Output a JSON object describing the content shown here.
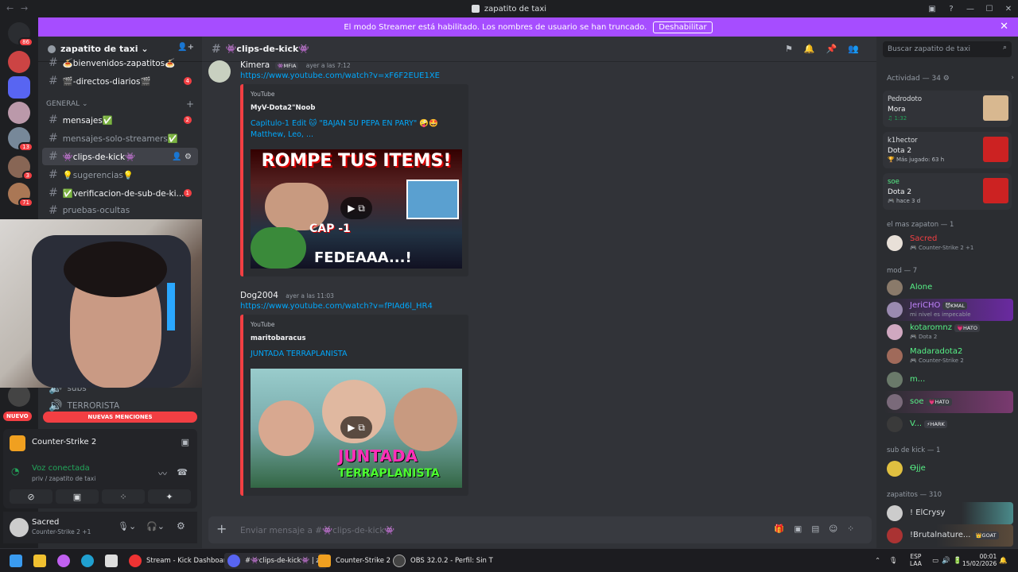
{
  "window": {
    "title": "zapatito de taxi",
    "back": "←",
    "forward": "→",
    "min": "—",
    "max": "☐",
    "close": "✕"
  },
  "banner": {
    "text": "El modo Streamer está habilitado. Los nombres de usuario se han truncado.",
    "button": "Deshabilitar",
    "close": "✕"
  },
  "guilds": [
    {
      "badge": "86",
      "color": "#e9e9e9"
    },
    {
      "badge": "",
      "color": "#c44"
    },
    {
      "badge": "",
      "color": "#5865f2"
    },
    {
      "badge": "",
      "color": "#b9a"
    },
    {
      "badge": "13",
      "color": "#789"
    },
    {
      "badge": "3",
      "color": "#865"
    },
    {
      "badge": "71",
      "color": "#a75"
    }
  ],
  "guild": {
    "name": "zapatito de taxi ⌄",
    "invite_icon": "👤+"
  },
  "channels": [
    {
      "name": "🍝bienvenidos-zapatitos🍝",
      "count": "",
      "state": "unread"
    },
    {
      "name": "🎬-directos-diarios🎬",
      "count": "4",
      "state": "unread"
    },
    {
      "name": "mensajes✅",
      "count": "2",
      "state": "unread"
    },
    {
      "name": "mensajes-solo-streamers✅",
      "count": "",
      "state": "normal"
    },
    {
      "name": "👾clips-de-kick👾",
      "count": "",
      "state": "active"
    },
    {
      "name": "💡sugerencias💡",
      "count": "",
      "state": "normal"
    },
    {
      "name": "✅verificacion-de-sub-de-ki...",
      "count": "1",
      "state": "unread"
    },
    {
      "name": "pruebas-ocultas",
      "count": "",
      "state": "normal"
    }
  ],
  "category": {
    "name": "GENERAL ⌄",
    "add": "+"
  },
  "voice_channels": [
    {
      "name": "subs"
    },
    {
      "name": "TERRORISTA"
    }
  ],
  "new_mentions": {
    "badge": "NUEVO",
    "label": "NUEVAS MENCIONES"
  },
  "activity_panel": {
    "game": "Counter-Strike 2",
    "voice_status": "Voz conectada",
    "voice_channel": "priv / zapatito de taxi"
  },
  "user": {
    "name": "Sacred",
    "status": "Counter-Strike 2 +1"
  },
  "chat": {
    "channel": "👾clips-de-kick👾",
    "messages": [
      {
        "author": "Kimera",
        "badge": "👾MFIA",
        "time": "ayer a las 7:12",
        "link": "https://www.youtube.com/watch?v=xF6F2EUE1XE",
        "embed": {
          "provider": "YouTube",
          "author": "MyV-Dota2\"Noob",
          "title": "Capitulo-1 Edit 🐱 \"BAJAN SU PEPA EN PARY\" 🤪🤩 Matthew, Leo, ...",
          "thumb_top": "ROMPE TUS ITEMS!",
          "thumb_mid": "CAP -1",
          "thumb_bottom": "FEDEAAA...!"
        }
      },
      {
        "author": "Dog2004",
        "badge": "",
        "time": "ayer a las 11:03",
        "link": "https://www.youtube.com/watch?v=fPIAd6l_HR4",
        "embed": {
          "provider": "YouTube",
          "author": "maritobaracus",
          "title": "JUNTADA TERRAPLANISTA",
          "thumb_top": "JUNTADA",
          "thumb_bottom": "TERRAPLANISTA"
        }
      }
    ],
    "composer_placeholder": "Enviar mensaje a #👾clips-de-kick👾"
  },
  "members": {
    "search_placeholder": "Buscar zapatito de taxi",
    "activity_header": "Actividad — 34 ⚙",
    "activities": [
      {
        "user": "Pedrodoto",
        "game": "Mora",
        "detail": "♫ 1:32"
      },
      {
        "user": "k1hector",
        "game": "Dota 2",
        "detail": "🏆 Más jugado: 63 h"
      },
      {
        "user": "soe",
        "game": "Dota 2",
        "detail": "🎮 hace 3 d"
      }
    ],
    "groups": [
      {
        "title": "el mas zapaton — 1",
        "members": [
          {
            "name": "Sacred",
            "tag": "",
            "status": "🎮 Counter-Strike 2 +1",
            "color": "#f23f43"
          }
        ]
      },
      {
        "title": "mod — 7",
        "members": [
          {
            "name": "Alone",
            "tag": "",
            "status": "",
            "color": "#57f287"
          },
          {
            "name": "JeriCHO",
            "tag": "😈KMAL",
            "status": "mi nivel es impecable",
            "color": "#c084fc"
          },
          {
            "name": "kotaromnz",
            "tag": "💗HATO",
            "status": "🎮 Dota 2",
            "color": "#57f287"
          },
          {
            "name": "Madaradota2",
            "tag": "",
            "status": "🎮 Counter-Strike 2",
            "color": "#57f287"
          },
          {
            "name": "m...",
            "tag": "",
            "status": "",
            "color": "#57f287"
          },
          {
            "name": "soe",
            "tag": "💗HATO",
            "status": "",
            "color": "#57f287"
          },
          {
            "name": "V...",
            "tag": "⚡HARK",
            "status": "",
            "color": "#57f287"
          }
        ]
      },
      {
        "title": "sub de kick — 1",
        "members": [
          {
            "name": "Ꝋjje",
            "tag": "",
            "status": "",
            "color": "#57f287"
          }
        ]
      },
      {
        "title": "zapatitos — 310",
        "members": [
          {
            "name": "! ElCrysy",
            "tag": "",
            "status": "",
            "color": "#dbdee1"
          },
          {
            "name": "!Brutalnature...",
            "tag": "👑GOAT",
            "status": "",
            "color": "#dbdee1"
          }
        ]
      }
    ]
  },
  "taskbar": {
    "apps": [
      {
        "label": "Stream - Kick Dashboar",
        "color": "#e33"
      },
      {
        "label": "#👾clips-de-kick👾 | za",
        "color": "#5865f2"
      },
      {
        "label": "Counter-Strike 2",
        "color": "#f0a020"
      },
      {
        "label": "OBS 32.0.2 - Perfil: Sin T",
        "color": "#444"
      }
    ],
    "lang": "ESP",
    "lang2": "LAA",
    "time": "00:01",
    "date": "15/02/2026"
  }
}
